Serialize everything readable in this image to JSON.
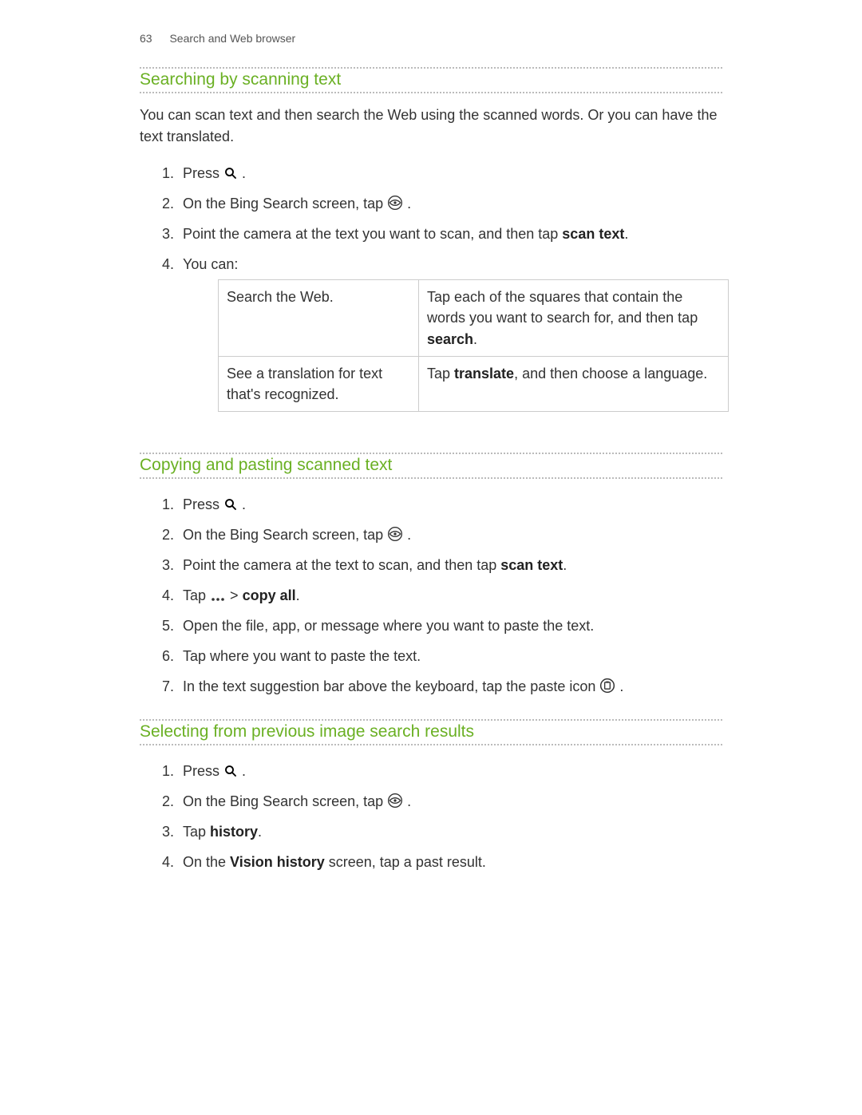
{
  "header": {
    "page_number": "63",
    "chapter": "Search and Web browser"
  },
  "section1": {
    "title": "Searching by scanning text",
    "intro": "You can scan text and then search the Web using the scanned words. Or you can have the text translated.",
    "step1_a": "Press ",
    "step1_b": " .",
    "step2_a": "On the Bing Search screen, tap ",
    "step2_b": ".",
    "step3_a": "Point the camera at the text you want to scan, and then tap ",
    "step3_bold": "scan text",
    "step3_b": ".",
    "step4": "You can:",
    "table": {
      "r1_left": "Search the Web.",
      "r1_right_a": "Tap each of the squares that contain the words you want to search for, and then tap ",
      "r1_right_bold": "search",
      "r1_right_b": ".",
      "r2_left": "See a translation for text that's recognized.",
      "r2_right_a": "Tap ",
      "r2_right_bold": "translate",
      "r2_right_b": ", and then choose a language."
    }
  },
  "section2": {
    "title": "Copying and pasting scanned text",
    "step1_a": "Press ",
    "step1_b": " .",
    "step2_a": "On the Bing Search screen, tap ",
    "step2_b": ".",
    "step3_a": "Point the camera at the text to scan, and then tap ",
    "step3_bold": "scan text",
    "step3_b": ".",
    "step4_a": "Tap ",
    "step4_mid": " > ",
    "step4_bold": "copy all",
    "step4_b": ".",
    "step5": "Open the file, app, or message where you want to paste the text.",
    "step6": "Tap where you want to paste the text.",
    "step7_a": "In the text suggestion bar above the keyboard, tap the paste icon ",
    "step7_b": "."
  },
  "section3": {
    "title": "Selecting from previous image search results",
    "step1_a": "Press ",
    "step1_b": " .",
    "step2_a": "On the Bing Search screen, tap ",
    "step2_b": ".",
    "step3_a": "Tap ",
    "step3_bold": "history",
    "step3_b": ".",
    "step4_a": "On the ",
    "step4_bold": "Vision history",
    "step4_b": " screen, tap a past result."
  }
}
